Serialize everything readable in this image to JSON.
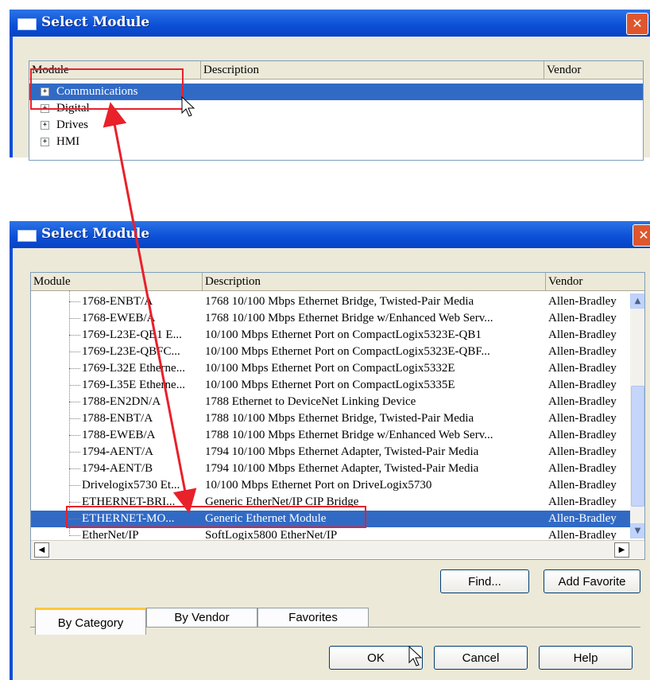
{
  "dialog_top": {
    "title": "Select Module",
    "columns": [
      "Module",
      "Description",
      "Vendor"
    ],
    "categories": [
      "Communications",
      "Digital",
      "Drives",
      "HMI"
    ],
    "close_glyph": "✕"
  },
  "dialog_bottom": {
    "title": "Select Module",
    "columns": [
      "Module",
      "Description",
      "Vendor"
    ],
    "close_glyph": "✕",
    "rows": [
      {
        "module": "1768-ENBT/A",
        "description": "1768 10/100 Mbps Ethernet Bridge, Twisted-Pair Media",
        "vendor": "Allen-Bradley"
      },
      {
        "module": "1768-EWEB/A",
        "description": "1768 10/100 Mbps Ethernet Bridge w/Enhanced Web Serv...",
        "vendor": "Allen-Bradley"
      },
      {
        "module": "1769-L23E-QB1 E...",
        "description": "10/100 Mbps Ethernet Port on CompactLogix5323E-QB1",
        "vendor": "Allen-Bradley"
      },
      {
        "module": "1769-L23E-QBFC...",
        "description": "10/100 Mbps Ethernet Port on CompactLogix5323E-QBF...",
        "vendor": "Allen-Bradley"
      },
      {
        "module": "1769-L32E Etherne...",
        "description": "10/100 Mbps Ethernet Port on CompactLogix5332E",
        "vendor": "Allen-Bradley"
      },
      {
        "module": "1769-L35E Etherne...",
        "description": "10/100 Mbps Ethernet Port on CompactLogix5335E",
        "vendor": "Allen-Bradley"
      },
      {
        "module": "1788-EN2DN/A",
        "description": "1788 Ethernet to DeviceNet Linking Device",
        "vendor": "Allen-Bradley"
      },
      {
        "module": "1788-ENBT/A",
        "description": "1788 10/100 Mbps Ethernet Bridge, Twisted-Pair Media",
        "vendor": "Allen-Bradley"
      },
      {
        "module": "1788-EWEB/A",
        "description": "1788 10/100 Mbps Ethernet Bridge w/Enhanced Web Serv...",
        "vendor": "Allen-Bradley"
      },
      {
        "module": "1794-AENT/A",
        "description": "1794 10/100 Mbps Ethernet Adapter, Twisted-Pair Media",
        "vendor": "Allen-Bradley"
      },
      {
        "module": "1794-AENT/B",
        "description": "1794 10/100 Mbps Ethernet Adapter, Twisted-Pair Media",
        "vendor": "Allen-Bradley"
      },
      {
        "module": "Drivelogix5730 Et...",
        "description": "10/100 Mbps Ethernet Port on DriveLogix5730",
        "vendor": "Allen-Bradley"
      },
      {
        "module": "ETHERNET-BRI...",
        "description": "Generic EtherNet/IP CIP Bridge",
        "vendor": "Allen-Bradley"
      },
      {
        "module": "ETHERNET-MO...",
        "description": "Generic Ethernet Module",
        "vendor": "Allen-Bradley"
      },
      {
        "module": "EtherNet/IP",
        "description": "SoftLogix5800 EtherNet/IP",
        "vendor": "Allen-Bradley"
      }
    ],
    "buttons": {
      "find": "Find...",
      "add_favorite": "Add Favorite",
      "ok": "OK",
      "cancel": "Cancel",
      "help": "Help"
    },
    "tabs": [
      "By Category",
      "By Vendor",
      "Favorites"
    ]
  },
  "colors": {
    "selection": "#316ac5",
    "highlight": "#e8212b",
    "titlebar": "#0a4fd6"
  },
  "icons": [
    "expand-plus-icon",
    "close-icon",
    "mouse-cursor-icon",
    "scroll-up-arrow-icon",
    "scroll-down-arrow-icon",
    "scroll-left-arrow-icon",
    "scroll-right-arrow-icon"
  ]
}
